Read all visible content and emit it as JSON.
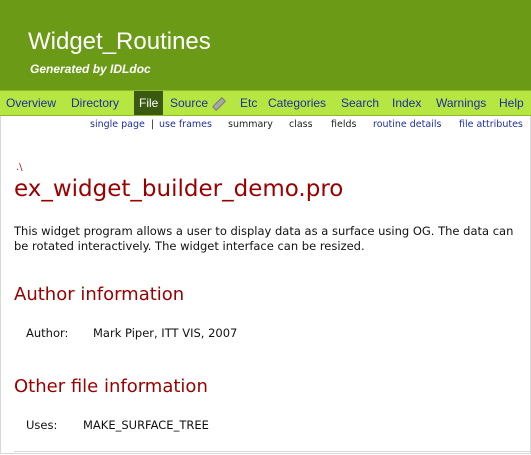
{
  "header": {
    "title": "Widget_Routines",
    "subtitle": "Generated by IDLdoc"
  },
  "nav": {
    "items": [
      "Overview",
      "Directory",
      "File",
      "Source",
      "Etc",
      "Categories",
      "Search",
      "Index",
      "Warnings",
      "Help"
    ],
    "active": "File",
    "source_icon": "pencil-icon"
  },
  "subnav": {
    "single_page": "single page",
    "separator": "|",
    "use_frames": "use frames",
    "summary": "summary",
    "class": "class",
    "fields": "fields",
    "routine_details": "routine details",
    "file_attributes": "file attributes"
  },
  "main": {
    "breadcrumb": ".\\",
    "file_title": "ex_widget_builder_demo.pro",
    "description": "This widget program allows a user to display data as a surface using OG. The data can be rotated interactively. The widget interface can be resized.",
    "author_section": {
      "heading": "Author information",
      "label": "Author:",
      "value": "Mark Piper, ITT VIS, 2007"
    },
    "other_section": {
      "heading": "Other file information",
      "label": "Uses:",
      "value": "MAKE_SURFACE_TREE"
    }
  },
  "colors": {
    "header_bg": "#6a9a16",
    "navbar_bg": "#b5e641",
    "active_tab_bg": "#3a5a12",
    "link": "#1c2fa0",
    "heading": "#990000"
  }
}
